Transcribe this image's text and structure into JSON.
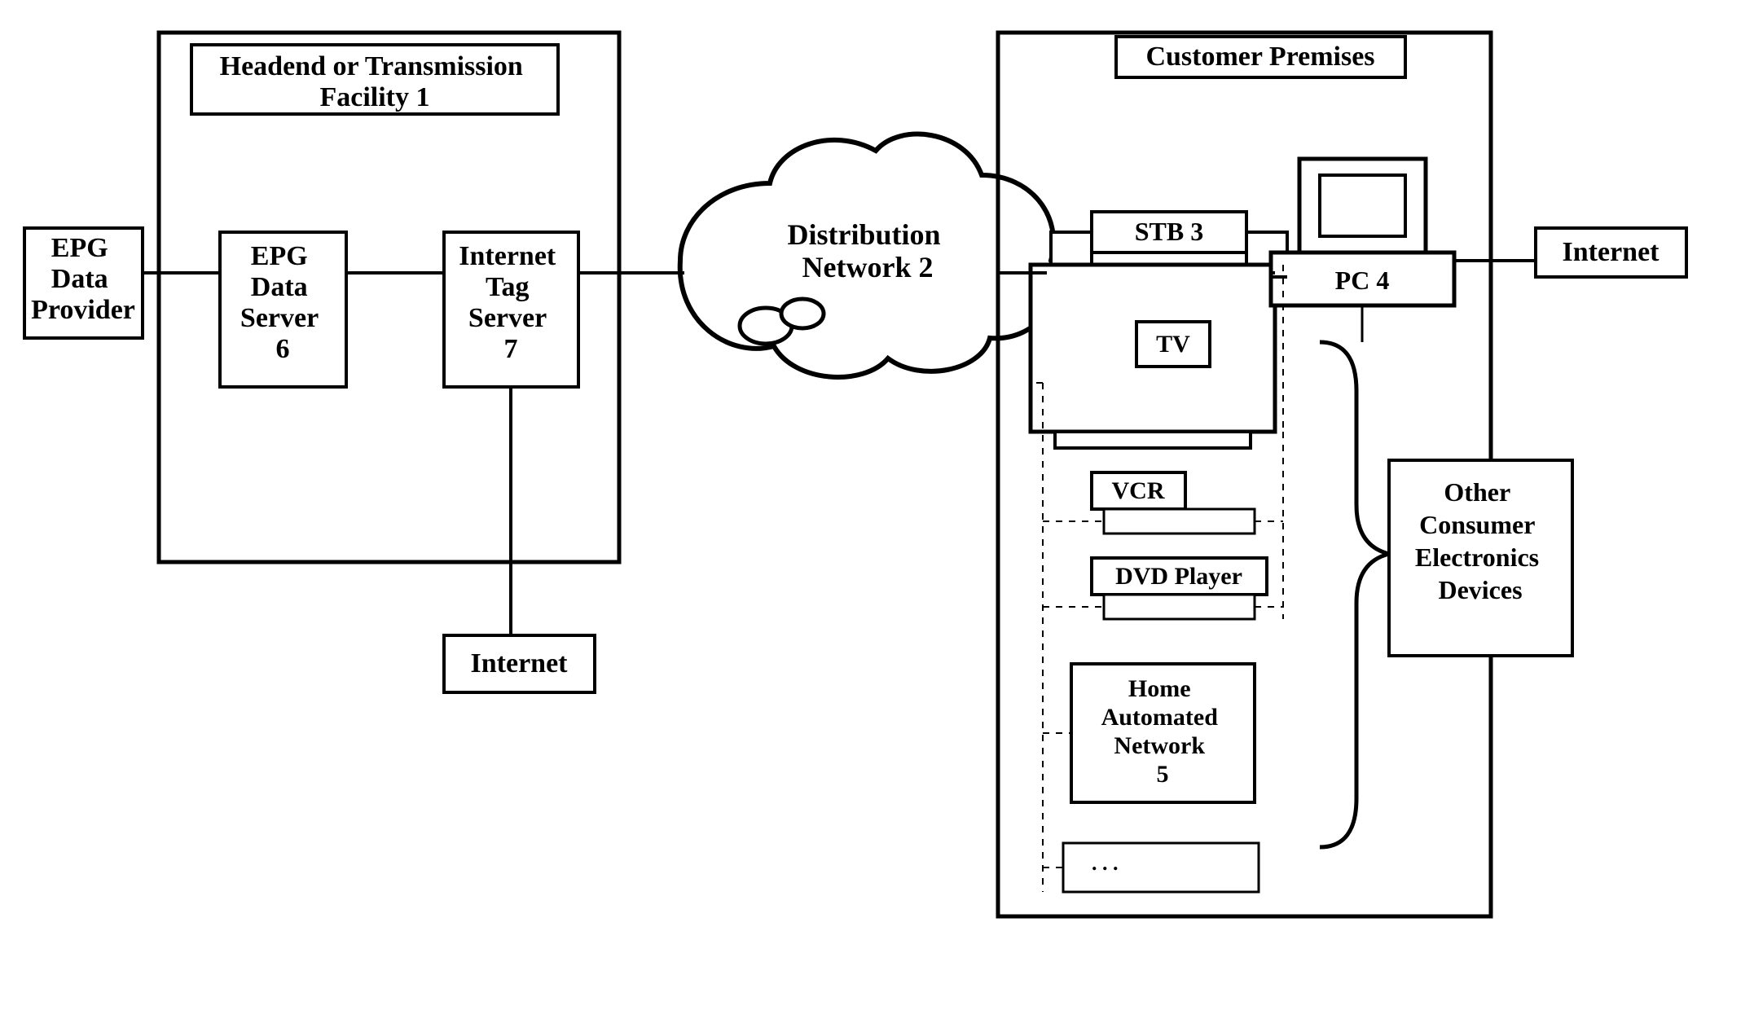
{
  "nodes": {
    "epg_provider": "EPG Data Provider",
    "headend_title": "Headend or Transmission Facility 1",
    "epg_server": "EPG Data Server 6",
    "tag_server": "Internet Tag Server 7",
    "internet_bottom": "Internet",
    "dist_network": "Distribution Network 2",
    "customer_title": "Customer Premises",
    "stb": "STB 3",
    "tv": "TV",
    "vcr": "VCR",
    "dvd": "DVD Player",
    "home_net": "Home Automated Network 5",
    "pc": "PC 4",
    "other_devices": "Other Consumer Electronics Devices",
    "internet_right": "Internet"
  }
}
